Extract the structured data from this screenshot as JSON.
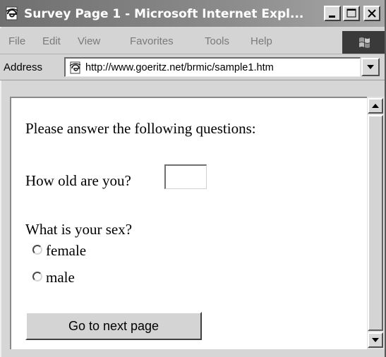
{
  "window": {
    "title": "Survey Page 1 - Microsoft Internet Expl...",
    "controls": {
      "minimize": "minimize",
      "maximize": "maximize",
      "close": "close"
    }
  },
  "menu": {
    "items": [
      "File",
      "Edit",
      "View",
      "Favorites",
      "Tools",
      "Help"
    ]
  },
  "address_bar": {
    "label": "Address",
    "url": "http://www.goeritz.net/brmic/sample1.htm"
  },
  "survey": {
    "intro": "Please answer the following questions:",
    "age_question": "How old are you?",
    "age_value": "",
    "sex_question": "What is your sex?",
    "sex_options": [
      "female",
      "male"
    ],
    "sex_selected": null,
    "next_button": "Go to next page"
  },
  "icons": {
    "app": "ie-page-icon",
    "address": "ie-page-icon",
    "throbber": "windows-logo-icon"
  },
  "colors": {
    "titlebar_start": "#6f6f6f",
    "titlebar_end": "#a8a8a8",
    "chrome": "#d4d4d4",
    "content_bg": "#ffffff"
  }
}
